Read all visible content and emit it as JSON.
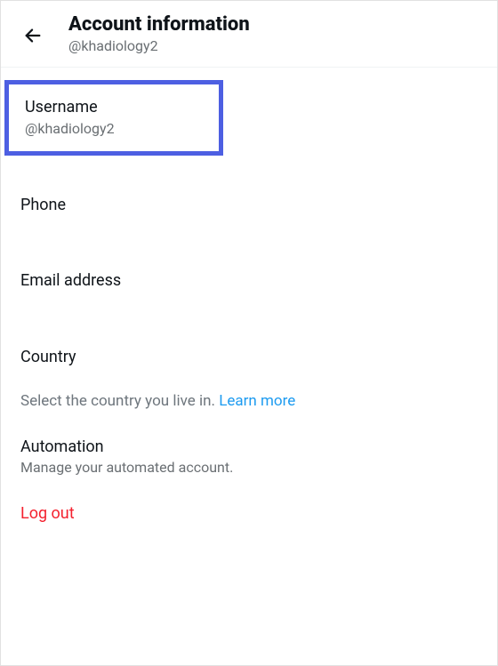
{
  "header": {
    "title": "Account information",
    "subtitle": "@khadiology2"
  },
  "username": {
    "label": "Username",
    "value": "@khadiology2"
  },
  "phone": {
    "label": "Phone"
  },
  "email": {
    "label": "Email address"
  },
  "country": {
    "label": "Country",
    "help_prefix": "Select the country you live in. ",
    "help_link": "Learn more"
  },
  "automation": {
    "label": "Automation",
    "subtitle": "Manage your automated account."
  },
  "logout": {
    "label": "Log out"
  }
}
